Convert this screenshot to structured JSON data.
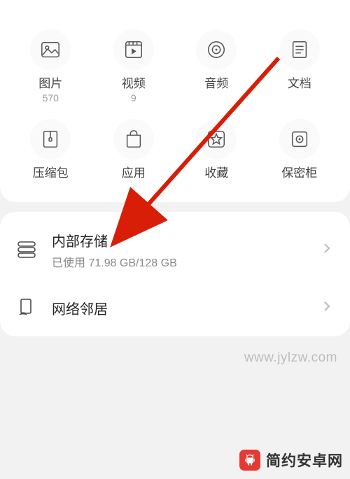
{
  "categories": [
    {
      "label": "图片",
      "count": "570",
      "icon": "image-icon"
    },
    {
      "label": "视频",
      "count": "9",
      "icon": "video-icon"
    },
    {
      "label": "音频",
      "count": "",
      "icon": "audio-icon"
    },
    {
      "label": "文档",
      "count": "",
      "icon": "document-icon"
    },
    {
      "label": "压缩包",
      "count": "",
      "icon": "archive-icon"
    },
    {
      "label": "应用",
      "count": "",
      "icon": "app-icon"
    },
    {
      "label": "收藏",
      "count": "",
      "icon": "favorite-icon"
    },
    {
      "label": "保密柜",
      "count": "",
      "icon": "safe-icon"
    }
  ],
  "storage": {
    "title": "内部存储",
    "subtitle": "已使用 71.98 GB/128 GB"
  },
  "network": {
    "title": "网络邻居"
  },
  "watermark": "www.jylzw.com",
  "brand": "简约安卓网"
}
